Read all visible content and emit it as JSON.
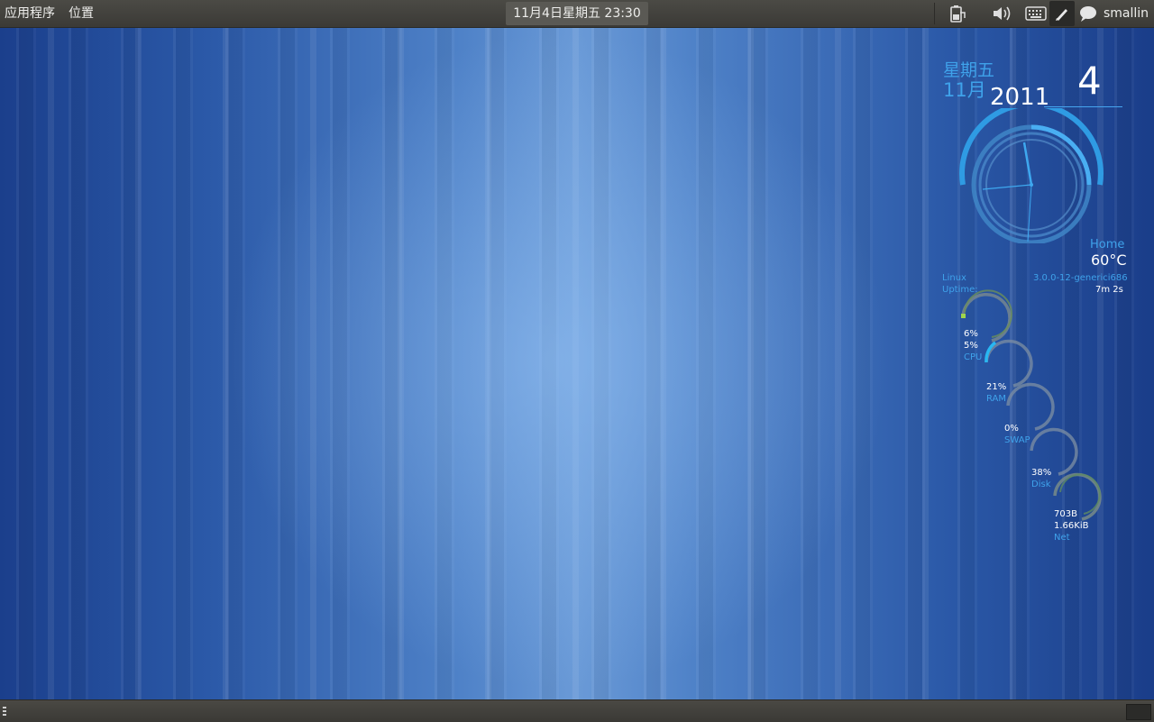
{
  "top_panel": {
    "apps_menu": "应用程序",
    "places_menu": "位置",
    "clock": "11月4日星期五 23:30",
    "user": "smallin",
    "icons": [
      "battery-icon",
      "volume-icon",
      "keyboard-icon",
      "pen-icon",
      "chat-bubble-icon"
    ]
  },
  "conky": {
    "weekday": "星期五",
    "month": "11月",
    "year": "2011",
    "day": "4",
    "home_label": "Home",
    "temperature": "60°C",
    "linux_label": "Linux",
    "uptime_label": "Uptime:",
    "kernel": "3.0.0-12-generici686",
    "uptime": "7m 2s",
    "gauges": {
      "cpu": {
        "value1": "6%",
        "value2": "5%",
        "label": "CPU",
        "fraction": 0.06
      },
      "ram": {
        "value": "21%",
        "label": "RAM",
        "fraction": 0.21
      },
      "swap": {
        "value": "0%",
        "label": "SWAP",
        "fraction": 0.0
      },
      "disk": {
        "value": "38%",
        "label": "Disk",
        "fraction": 0.38
      },
      "net": {
        "value1": "703B",
        "value2": "1.66KiB",
        "label": "Net"
      }
    }
  },
  "colors": {
    "accent": "#3fa2ea",
    "panel": "#3f3e3a",
    "wallpaper_center": "#7aa8e0",
    "wallpaper_edge": "#1b3f8c"
  }
}
